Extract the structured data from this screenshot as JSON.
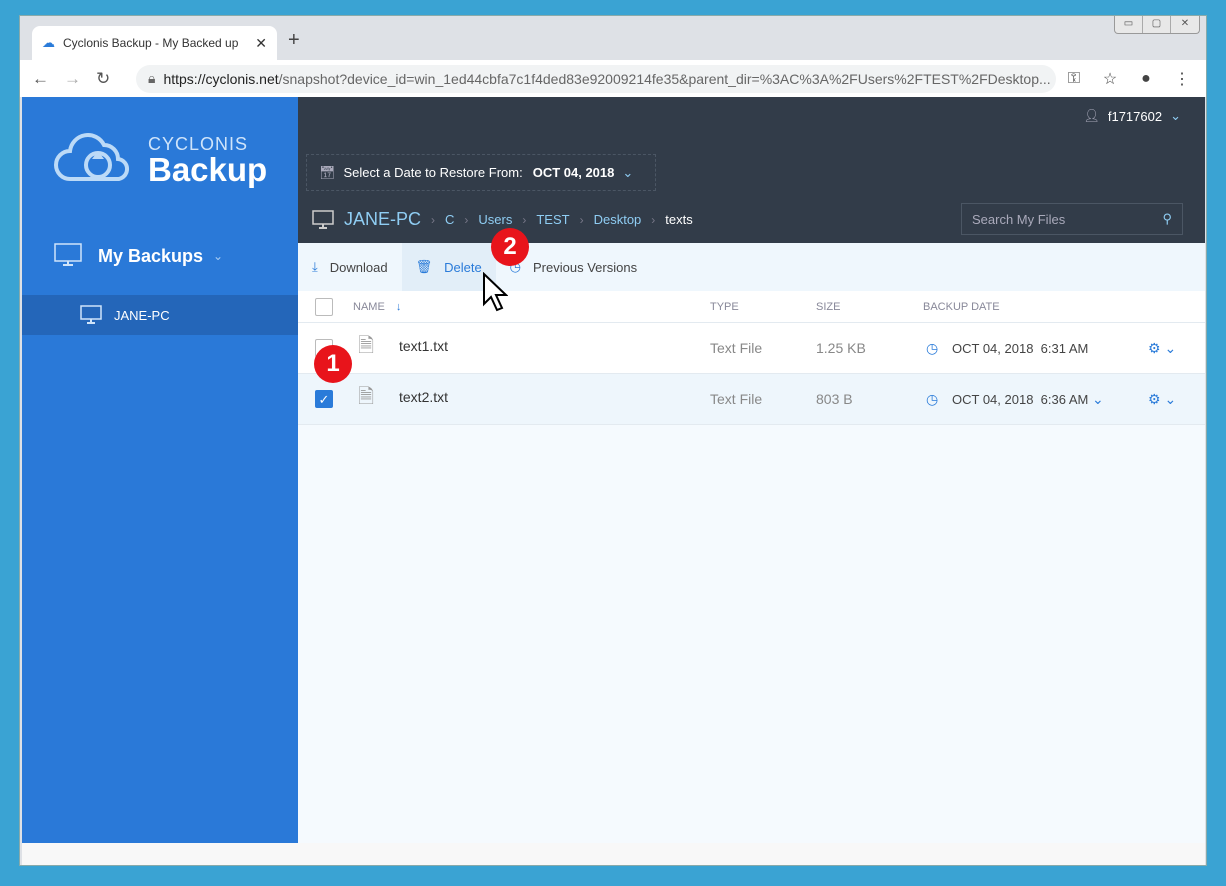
{
  "browser": {
    "tab_title": "Cyclonis Backup - My Backed up",
    "url_host": "https://cyclonis.net",
    "url_path": "/snapshot?device_id=win_1ed44cbfa7c1f4ded83e92009214fe35&parent_dir=%3AC%3A%2FUsers%2FTEST%2FDesktop..."
  },
  "sidebar": {
    "brand_top": "CYCLONIS",
    "brand_bottom": "Backup",
    "my_backups": "My Backups",
    "device": "JANE-PC"
  },
  "header": {
    "user": "f1717602",
    "date_label": "Select a Date to Restore From:",
    "date_value": "OCT 04, 2018",
    "search_placeholder": "Search My Files",
    "breadcrumb": [
      "JANE-PC",
      "C",
      "Users",
      "TEST",
      "Desktop",
      "texts"
    ]
  },
  "toolbar": {
    "download": "Download",
    "delete": "Delete",
    "previous_versions": "Previous Versions"
  },
  "table": {
    "headers": {
      "name": "NAME",
      "type": "TYPE",
      "size": "SIZE",
      "date": "BACKUP DATE"
    },
    "rows": [
      {
        "name": "text1.txt",
        "type": "Text File",
        "size": "1.25 KB",
        "date": "OCT 04, 2018  6:31 AM",
        "checked": false
      },
      {
        "name": "text2.txt",
        "type": "Text File",
        "size": "803 B",
        "date": "OCT 04, 2018  6:36 AM",
        "checked": true
      }
    ]
  },
  "annotations": {
    "step1": "1",
    "step2": "2"
  }
}
